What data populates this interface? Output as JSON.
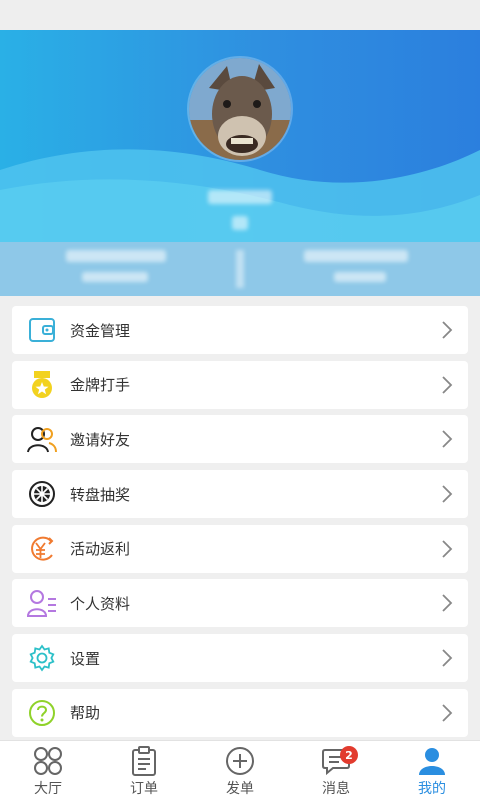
{
  "menu": {
    "items": [
      {
        "label": "资金管理",
        "icon": "wallet-icon"
      },
      {
        "label": "金牌打手",
        "icon": "gold-medal-icon"
      },
      {
        "label": "邀请好友",
        "icon": "invite-friends-icon"
      },
      {
        "label": "转盘抽奖",
        "icon": "wheel-lottery-icon"
      },
      {
        "label": "活动返利",
        "icon": "yuan-rebate-icon"
      },
      {
        "label": "个人资料",
        "icon": "profile-icon"
      },
      {
        "label": "设置",
        "icon": "gear-icon"
      },
      {
        "label": "帮助",
        "icon": "help-icon"
      }
    ]
  },
  "tabbar": {
    "tabs": [
      {
        "label": "大厅",
        "icon": "hall-icon"
      },
      {
        "label": "订单",
        "icon": "clipboard-icon"
      },
      {
        "label": "发单",
        "icon": "plus-circle-icon"
      },
      {
        "label": "消息",
        "icon": "chat-icon",
        "badge": "2"
      },
      {
        "label": "我的",
        "icon": "user-icon",
        "active": true
      }
    ]
  },
  "colors": {
    "accent": "#2a8ee0",
    "header_start": "#2ab0e6",
    "header_end": "#2b7fde",
    "badge": "#e23b2e"
  }
}
